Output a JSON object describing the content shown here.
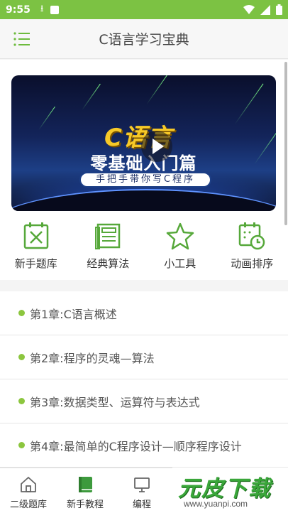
{
  "status_bar": {
    "time": "9:55"
  },
  "app_bar": {
    "title": "C语言学习宝典"
  },
  "banner": {
    "logo_text": "C语言",
    "headline": "零基础入门篇",
    "subtitle": "手把手带你写C程序"
  },
  "shortcuts": [
    {
      "label": "新手题库",
      "icon": "exam-icon"
    },
    {
      "label": "经典算法",
      "icon": "book-icon"
    },
    {
      "label": "小工具",
      "icon": "star-icon"
    },
    {
      "label": "动画排序",
      "icon": "calendar-clock-icon"
    }
  ],
  "chapters": [
    "第1章:C语言概述",
    "第2章:程序的灵魂—算法",
    "第3章:数据类型、运算符与表达式",
    "第4章:最简单的C程序设计—顺序程序设计"
  ],
  "bottom_nav": [
    {
      "label": "二级题库",
      "icon": "home-icon",
      "active": false
    },
    {
      "label": "新手教程",
      "icon": "book-icon",
      "active": true
    },
    {
      "label": "编程",
      "icon": "monitor-icon",
      "active": false
    }
  ],
  "watermark": {
    "text": "元皮下载",
    "url": "www.yuanpi.com"
  },
  "colors": {
    "accent": "#7cc243",
    "dot": "#8cc63f",
    "icon_green": "#56a83a"
  }
}
